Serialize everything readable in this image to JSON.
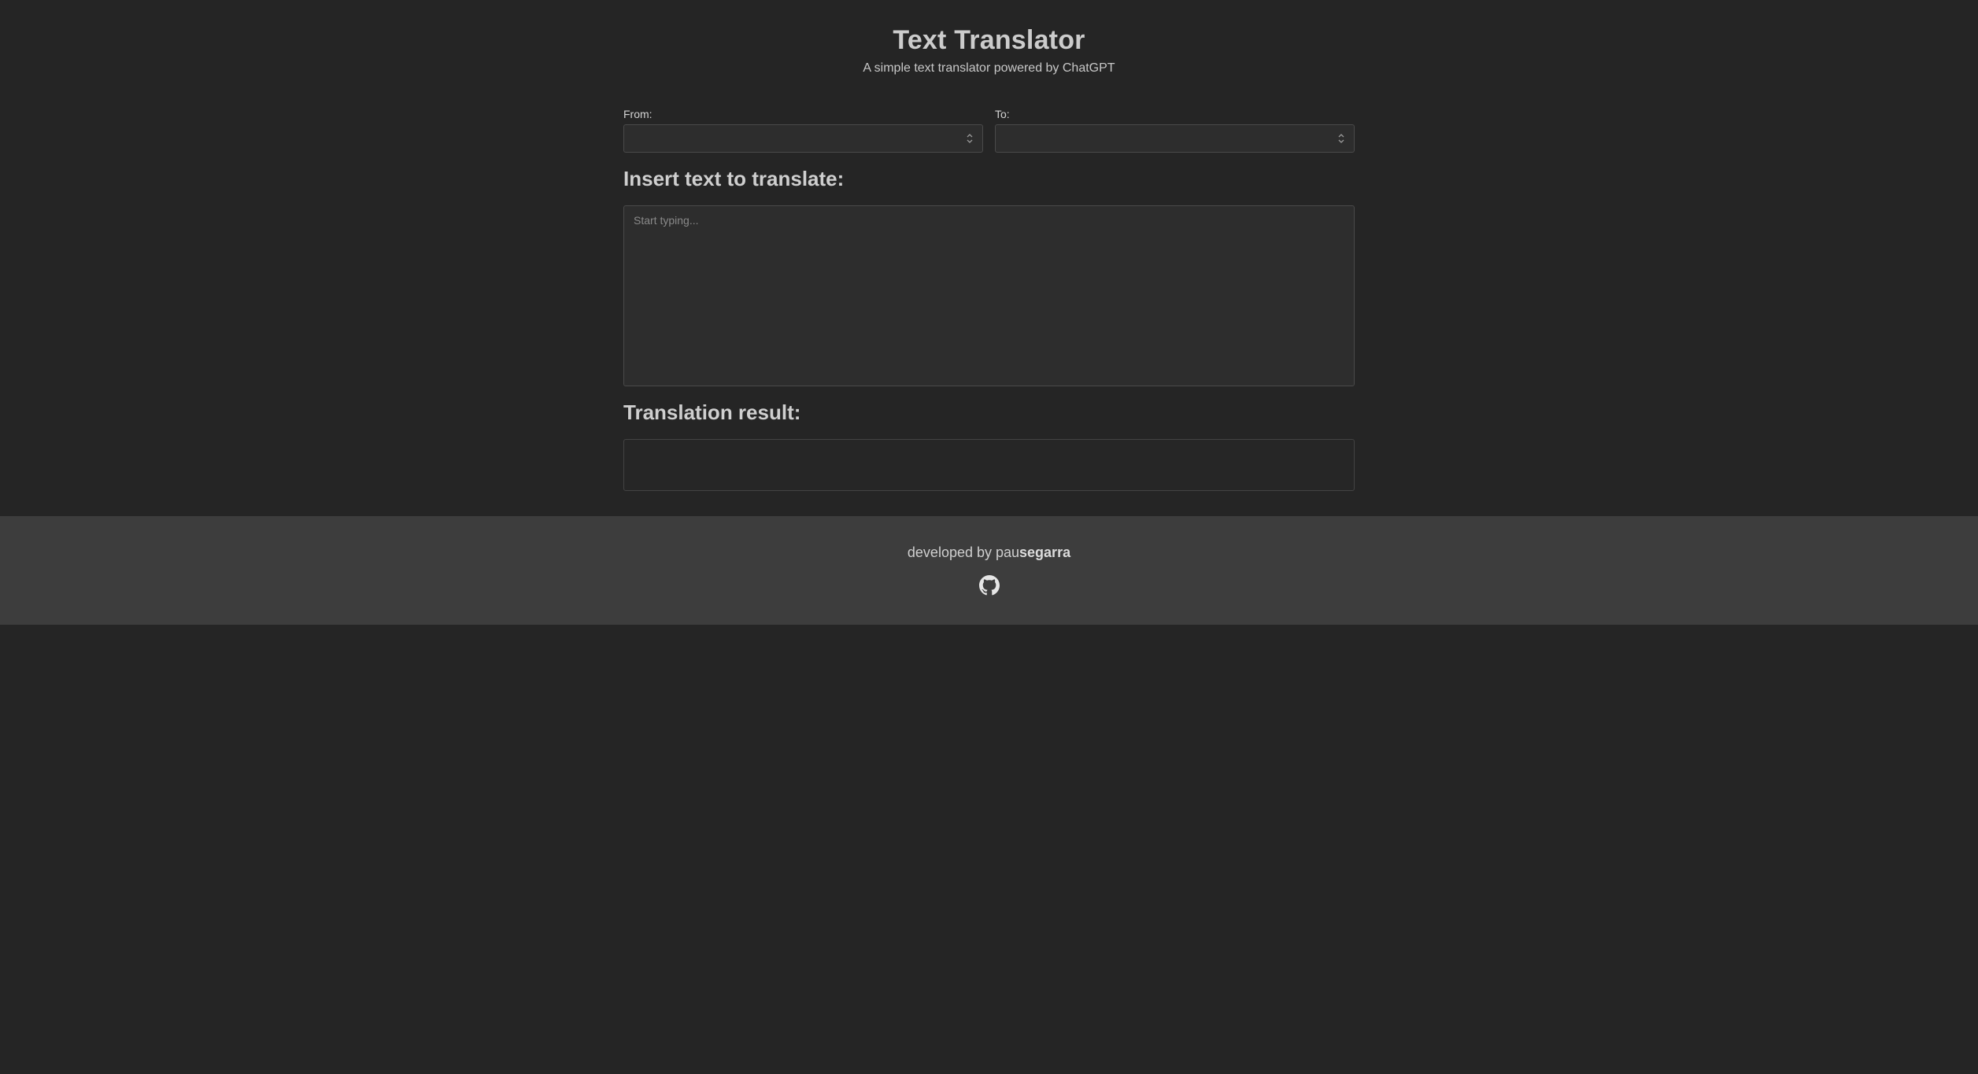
{
  "header": {
    "title": "Text Translator",
    "subtitle": "A simple text translator powered by ChatGPT"
  },
  "form": {
    "from_label": "From:",
    "from_value": "",
    "to_label": "To:",
    "to_value": "",
    "input_heading": "Insert text to translate:",
    "input_placeholder": "Start typing...",
    "input_value": "",
    "result_heading": "Translation result:",
    "result_value": ""
  },
  "footer": {
    "credit_prefix": "developed by pau",
    "credit_name": "segarra",
    "github_icon": "github-icon"
  },
  "colors": {
    "background": "#252525",
    "footer_background": "#3d3d3d",
    "field_background": "#2d2d2d",
    "field_border": "#4a4a4a",
    "text": "#cfcfcf"
  }
}
